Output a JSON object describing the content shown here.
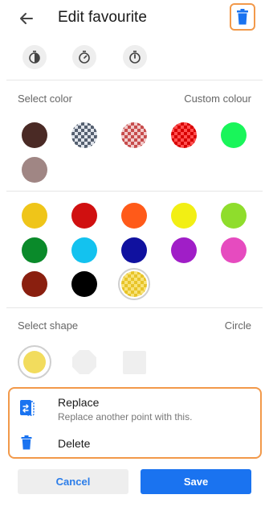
{
  "header": {
    "title": "Edit favourite",
    "back_icon": "arrow-left-icon",
    "delete_icon": "trash-icon",
    "accent": "#1a73f0",
    "highlight": "#f2994a"
  },
  "icon_row": [
    "timer-icon",
    "stopwatch-icon",
    "timer-icon"
  ],
  "color_section": {
    "label": "Select color",
    "right_label": "Custom colour",
    "custom_colors": [
      "#4a2a25",
      "checker-gray",
      "checker-red",
      "checker-brightred",
      "#19f55a",
      "#a08684"
    ],
    "palette": [
      "#efc519",
      "#d01010",
      "#ff5a19",
      "#f2ef14",
      "#8fdd2c",
      "#0a8a2a",
      "#13c2ef",
      "#10119f",
      "#a01ec7",
      "#e64bbf",
      "#8a1f0f",
      "#000000",
      "checker-yellow"
    ],
    "selected": "checker-yellow"
  },
  "shape_section": {
    "label": "Select shape",
    "value": "Circle",
    "shapes": [
      "circle",
      "octagon",
      "square"
    ],
    "selected": "circle"
  },
  "sheet": {
    "replace": {
      "title": "Replace",
      "subtitle": "Replace another point with this.",
      "icon": "replace-point-icon"
    },
    "delete": {
      "title": "Delete",
      "icon": "trash-icon"
    }
  },
  "buttons": {
    "cancel": "Cancel",
    "save": "Save"
  }
}
